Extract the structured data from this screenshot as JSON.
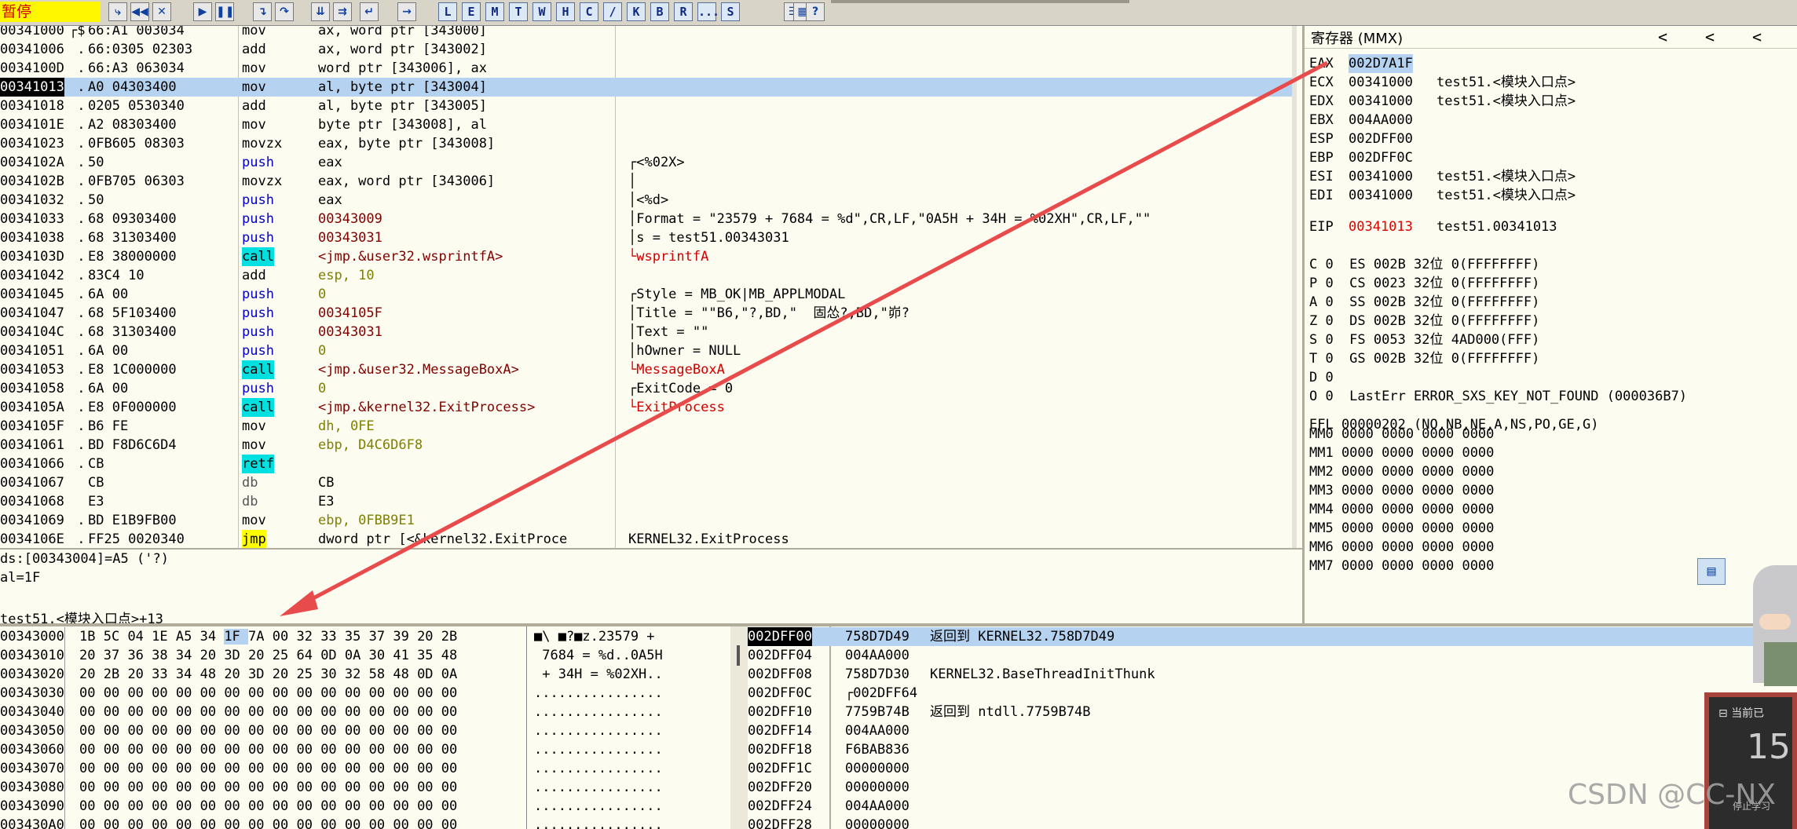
{
  "toolbar": {
    "status": "暂停",
    "letter_buttons": [
      "L",
      "E",
      "M",
      "T",
      "W",
      "H",
      "C",
      "/",
      "K",
      "B",
      "R",
      "...",
      "S"
    ]
  },
  "disasm": {
    "rows": [
      {
        "addr": "00341000",
        "mark": "┌$",
        "hex": "66:A1 003034",
        "mn": "mov",
        "op": "ax, word ptr [343000]",
        "cm": ""
      },
      {
        "addr": "00341006",
        "mark": " .",
        "hex": "66:0305 02303",
        "mn": "add",
        "op": "ax, word ptr [343002]",
        "cm": ""
      },
      {
        "addr": "0034100D",
        "mark": " .",
        "hex": "66:A3 063034",
        "mn": "mov",
        "op": "word ptr [343006], ax",
        "cm": ""
      },
      {
        "addr": "00341013",
        "mark": " .",
        "hex": "A0 04303400",
        "mn": "mov",
        "op": "al, byte ptr [343004]",
        "cm": ""
      },
      {
        "addr": "00341018",
        "mark": " .",
        "hex": "0205 0530340",
        "mn": "add",
        "op": "al, byte ptr [343005]",
        "cm": ""
      },
      {
        "addr": "0034101E",
        "mark": " .",
        "hex": "A2 08303400",
        "mn": "mov",
        "op": "byte ptr [343008], al",
        "cm": ""
      },
      {
        "addr": "00341023",
        "mark": " .",
        "hex": "0FB605 08303",
        "mn": "movzx",
        "op": "eax, byte ptr [343008]",
        "cm": ""
      },
      {
        "addr": "0034102A",
        "mark": " .",
        "hex": "50",
        "mn": "push",
        "op": "eax",
        "cm": "┌<%02X>"
      },
      {
        "addr": "0034102B",
        "mark": " .",
        "hex": "0FB705 06303",
        "mn": "movzx",
        "op": "eax, word ptr [343006]",
        "cm": "│"
      },
      {
        "addr": "00341032",
        "mark": " .",
        "hex": "50",
        "mn": "push",
        "op": "eax",
        "cm": "│<%d>"
      },
      {
        "addr": "00341033",
        "mark": " .",
        "hex": "68 09303400",
        "mn": "push",
        "op": "00343009",
        "cm": "│Format = \"23579 + 7684 = %d\",CR,LF,\"0A5H + 34H = %02XH\",CR,LF,\"\""
      },
      {
        "addr": "00341038",
        "mark": " .",
        "hex": "68 31303400",
        "mn": "push",
        "op": "00343031",
        "cm": "│s = test51.00343031"
      },
      {
        "addr": "0034103D",
        "mark": " .",
        "hex": "E8 38000000",
        "mn": "call",
        "op": "<jmp.&user32.wsprintfA>",
        "cm": "└wsprintfA"
      },
      {
        "addr": "00341042",
        "mark": " .",
        "hex": "83C4 10",
        "mn": "add",
        "op": "esp, 10",
        "cm": ""
      },
      {
        "addr": "00341045",
        "mark": " .",
        "hex": "6A 00",
        "mn": "push",
        "op": "0",
        "cm": "┌Style = MB_OK|MB_APPLMODAL"
      },
      {
        "addr": "00341047",
        "mark": " .",
        "hex": "68 5F103400",
        "mn": "push",
        "op": "0034105F",
        "cm": "│Title = \"\"B6,\"?,BD,\"  固怂?,BD,\"峁?"
      },
      {
        "addr": "0034104C",
        "mark": " .",
        "hex": "68 31303400",
        "mn": "push",
        "op": "00343031",
        "cm": "│Text = \"\""
      },
      {
        "addr": "00341051",
        "mark": " .",
        "hex": "6A 00",
        "mn": "push",
        "op": "0",
        "cm": "│hOwner = NULL"
      },
      {
        "addr": "00341053",
        "mark": " .",
        "hex": "E8 1C000000",
        "mn": "call",
        "op": "<jmp.&user32.MessageBoxA>",
        "cm": "└MessageBoxA"
      },
      {
        "addr": "00341058",
        "mark": " .",
        "hex": "6A 00",
        "mn": "push",
        "op": "0",
        "cm": "┌ExitCode = 0"
      },
      {
        "addr": "0034105A",
        "mark": " .",
        "hex": "E8 0F000000",
        "mn": "call",
        "op": "<jmp.&kernel32.ExitProcess>",
        "cm": "└ExitProcess"
      },
      {
        "addr": "0034105F",
        "mark": " .",
        "hex": "B6 FE",
        "mn": "mov",
        "op": "dh, 0FE",
        "cm": ""
      },
      {
        "addr": "00341061",
        "mark": " .",
        "hex": "BD F8D6C6D4",
        "mn": "mov",
        "op": "ebp, D4C6D6F8",
        "cm": ""
      },
      {
        "addr": "00341066",
        "mark": " .",
        "hex": "CB",
        "mn": "retf",
        "op": "",
        "cm": ""
      },
      {
        "addr": "00341067",
        "mark": "  ",
        "hex": "CB",
        "mn": "db",
        "op": "CB",
        "cm": ""
      },
      {
        "addr": "00341068",
        "mark": "  ",
        "hex": "E3",
        "mn": "db",
        "op": "E3",
        "cm": ""
      },
      {
        "addr": "00341069",
        "mark": " .",
        "hex": "BD E1B9FB00",
        "mn": "mov",
        "op": "ebp, 0FBB9E1",
        "cm": ""
      },
      {
        "addr": "0034106E",
        "mark": " .",
        "hex": "FF25 0020340",
        "mn": "jmp",
        "op": "dword ptr [<&kernel32.ExitProce",
        "cm": "KERNEL32.ExitProcess"
      }
    ]
  },
  "info": {
    "line1": "ds:[00343004]=A5 ('?)",
    "line2": "al=1F",
    "line3": "",
    "line4": "test51.<模块入口点>+13"
  },
  "registers": {
    "title": "寄存器 (MMX)",
    "nav": [
      "<",
      "<",
      "<"
    ],
    "gp": [
      {
        "name": "EAX",
        "val": "002D7A1F",
        "txt": ""
      },
      {
        "name": "ECX",
        "val": "00341000",
        "txt": "test51.<模块入口点>"
      },
      {
        "name": "EDX",
        "val": "00341000",
        "txt": "test51.<模块入口点>"
      },
      {
        "name": "EBX",
        "val": "004AA000",
        "txt": ""
      },
      {
        "name": "ESP",
        "val": "002DFF00",
        "txt": ""
      },
      {
        "name": "EBP",
        "val": "002DFF0C",
        "txt": ""
      },
      {
        "name": "ESI",
        "val": "00341000",
        "txt": "test51.<模块入口点>"
      },
      {
        "name": "EDI",
        "val": "00341000",
        "txt": "test51.<模块入口点>"
      }
    ],
    "eip": {
      "name": "EIP",
      "val": "00341013",
      "txt": "test51.00341013"
    },
    "flags": [
      "C 0  ES 002B 32位 0(FFFFFFFF)",
      "P 0  CS 0023 32位 0(FFFFFFFF)",
      "A 0  SS 002B 32位 0(FFFFFFFF)",
      "Z 0  DS 002B 32位 0(FFFFFFFF)",
      "S 0  FS 0053 32位 4AD000(FFF)",
      "T 0  GS 002B 32位 0(FFFFFFFF)",
      "D 0",
      "O 0  LastErr ERROR_SXS_KEY_NOT_FOUND (000036B7)"
    ],
    "efl": "EFL 00000202 (NO,NB,NE,A,NS,PO,GE,G)",
    "mmx": [
      "MM0 0000 0000 0000 0000",
      "MM1 0000 0000 0000 0000",
      "MM2 0000 0000 0000 0000",
      "MM3 0000 0000 0000 0000",
      "MM4 0000 0000 0000 0000",
      "MM5 0000 0000 0000 0000",
      "MM6 0000 0000 0000 0000",
      "MM7 0000 0000 0000 0000"
    ]
  },
  "dump": {
    "rows": [
      {
        "addr": "00343000",
        "hex": "1B 5C 04 1E A5 34 1F 7A 00 32 33 35 37 39 20 2B",
        "ascii": "■\\ ■?■z.23579 +"
      },
      {
        "addr": "00343010",
        "hex": "20 37 36 38 34 20 3D 20 25 64 0D 0A 30 41 35 48",
        "ascii": " 7684 = %d..0A5H"
      },
      {
        "addr": "00343020",
        "hex": "20 2B 20 33 34 48 20 3D 20 25 30 32 58 48 0D 0A",
        "ascii": " + 34H = %02XH.."
      },
      {
        "addr": "00343030",
        "hex": "00 00 00 00 00 00 00 00 00 00 00 00 00 00 00 00",
        "ascii": "................"
      },
      {
        "addr": "00343040",
        "hex": "00 00 00 00 00 00 00 00 00 00 00 00 00 00 00 00",
        "ascii": "................"
      },
      {
        "addr": "00343050",
        "hex": "00 00 00 00 00 00 00 00 00 00 00 00 00 00 00 00",
        "ascii": "................"
      },
      {
        "addr": "00343060",
        "hex": "00 00 00 00 00 00 00 00 00 00 00 00 00 00 00 00",
        "ascii": "................"
      },
      {
        "addr": "00343070",
        "hex": "00 00 00 00 00 00 00 00 00 00 00 00 00 00 00 00",
        "ascii": "................"
      },
      {
        "addr": "00343080",
        "hex": "00 00 00 00 00 00 00 00 00 00 00 00 00 00 00 00",
        "ascii": "................"
      },
      {
        "addr": "00343090",
        "hex": "00 00 00 00 00 00 00 00 00 00 00 00 00 00 00 00",
        "ascii": "................"
      },
      {
        "addr": "003430A0",
        "hex": "00 00 00 00 00 00 00 00 00 00 00 00 00 00 00 00",
        "ascii": "................"
      }
    ]
  },
  "stack": {
    "rows": [
      {
        "addr": "002DFF00",
        "val": "758D7D49",
        "txt": "返回到 KERNEL32.758D7D49"
      },
      {
        "addr": "002DFF04",
        "val": "004AA000",
        "txt": ""
      },
      {
        "addr": "002DFF08",
        "val": "758D7D30",
        "txt": "KERNEL32.BaseThreadInitThunk"
      },
      {
        "addr": "002DFF0C",
        "val": "┌002DFF64",
        "txt": ""
      },
      {
        "addr": "002DFF10",
        "val": "7759B74B",
        "txt": "返回到 ntdll.7759B74B"
      },
      {
        "addr": "002DFF14",
        "val": "004AA000",
        "txt": ""
      },
      {
        "addr": "002DFF18",
        "val": "F6BAB836",
        "txt": ""
      },
      {
        "addr": "002DFF1C",
        "val": "00000000",
        "txt": ""
      },
      {
        "addr": "002DFF20",
        "val": "00000000",
        "txt": ""
      },
      {
        "addr": "002DFF24",
        "val": "004AA000",
        "txt": ""
      },
      {
        "addr": "002DFF28",
        "val": "00000000",
        "txt": ""
      }
    ]
  },
  "overlay": {
    "widget_label": "当前已",
    "widget_number": "15",
    "widget_sub": "停止学习",
    "watermark": "CSDN @CC-NX"
  }
}
